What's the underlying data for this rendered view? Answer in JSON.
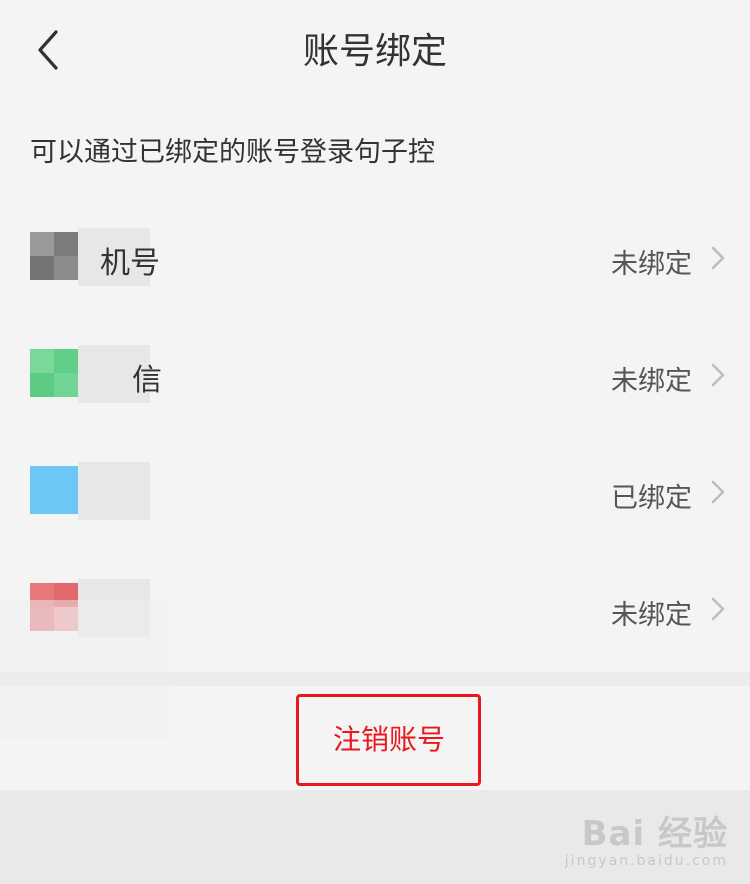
{
  "header": {
    "title": "账号绑定"
  },
  "hint": "可以通过已绑定的账号登录句子控",
  "accounts": [
    {
      "label": "机号",
      "status": "未绑定",
      "icon": "phone-icon",
      "color": "#8a8a8a"
    },
    {
      "label": "信",
      "status": "未绑定",
      "icon": "wechat-icon",
      "color": "#5fcf85"
    },
    {
      "label": "",
      "status": "已绑定",
      "icon": "qq-icon",
      "color": "#5ec2f4"
    },
    {
      "label": "",
      "status": "未绑定",
      "icon": "weibo-icon",
      "color": "#e46b6f"
    }
  ],
  "logout": {
    "label": "注销账号"
  },
  "watermark": {
    "brand": "Bai 经验",
    "sub": "jingyan.baidu.com"
  }
}
